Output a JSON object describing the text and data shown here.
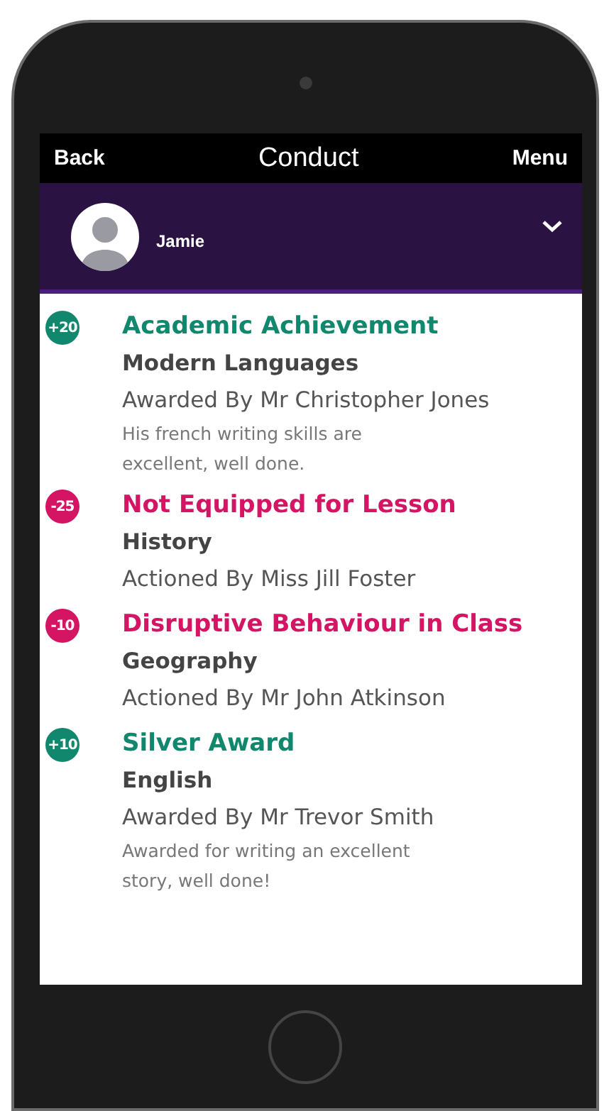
{
  "nav_bar": {
    "back": "Back",
    "title": "Conduct",
    "menu": "Menu"
  },
  "student": {
    "name": "Jamie",
    "expanded": false
  },
  "entries": [
    {
      "kind": "award",
      "points": "+20",
      "title": "Academic Achievement",
      "subject": "Modern Languages",
      "staff": "Awarded By Mr Christopher Jones",
      "comment": "His french writing skills are excellent, well done."
    },
    {
      "kind": "sanction",
      "points": "-25",
      "title": "Not Equipped for Lesson",
      "subject": "History",
      "staff": "Actioned By Miss Jill Foster"
    },
    {
      "kind": "sanction",
      "points": "-10",
      "title": "Disruptive Behaviour in Class",
      "subject": "Geography",
      "staff": "Actioned By Mr John Atkinson"
    },
    {
      "kind": "award",
      "points": "+10",
      "title": "Silver Award",
      "subject": "English",
      "staff": "Awarded By Mr Trevor Smith",
      "comment": "Awarded for writing an excellent story, well done!"
    }
  ]
}
